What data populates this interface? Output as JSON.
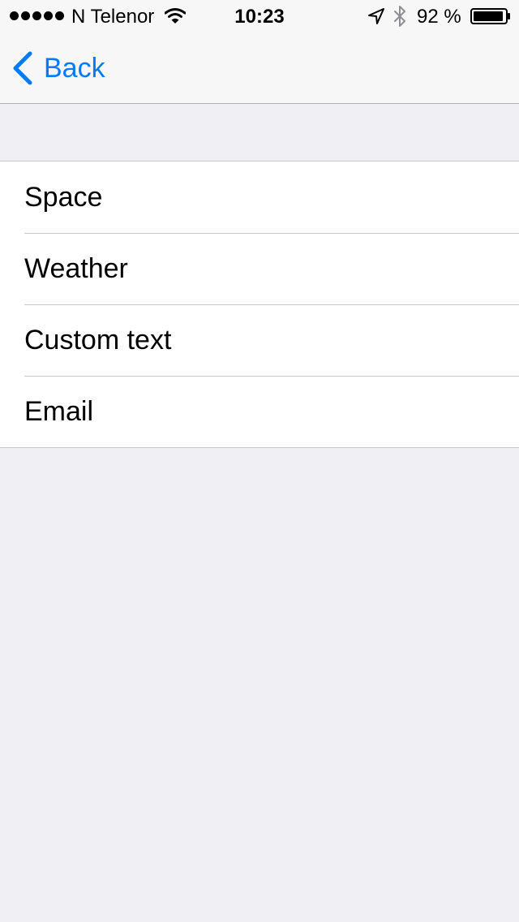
{
  "status_bar": {
    "carrier": "N Telenor",
    "time": "10:23",
    "battery_percent": "92 %",
    "signal_bars": 5,
    "icons": [
      "wifi-icon",
      "location-icon",
      "bluetooth-icon",
      "battery-icon"
    ]
  },
  "nav": {
    "back_label": "Back",
    "accent_color": "#007aff"
  },
  "menu": {
    "items": [
      {
        "label": "Space"
      },
      {
        "label": "Weather"
      },
      {
        "label": "Custom text"
      },
      {
        "label": "Email"
      }
    ]
  },
  "colors": {
    "background": "#efeff4",
    "nav_background": "#f7f7f7",
    "separator": "#c8c7cc"
  }
}
